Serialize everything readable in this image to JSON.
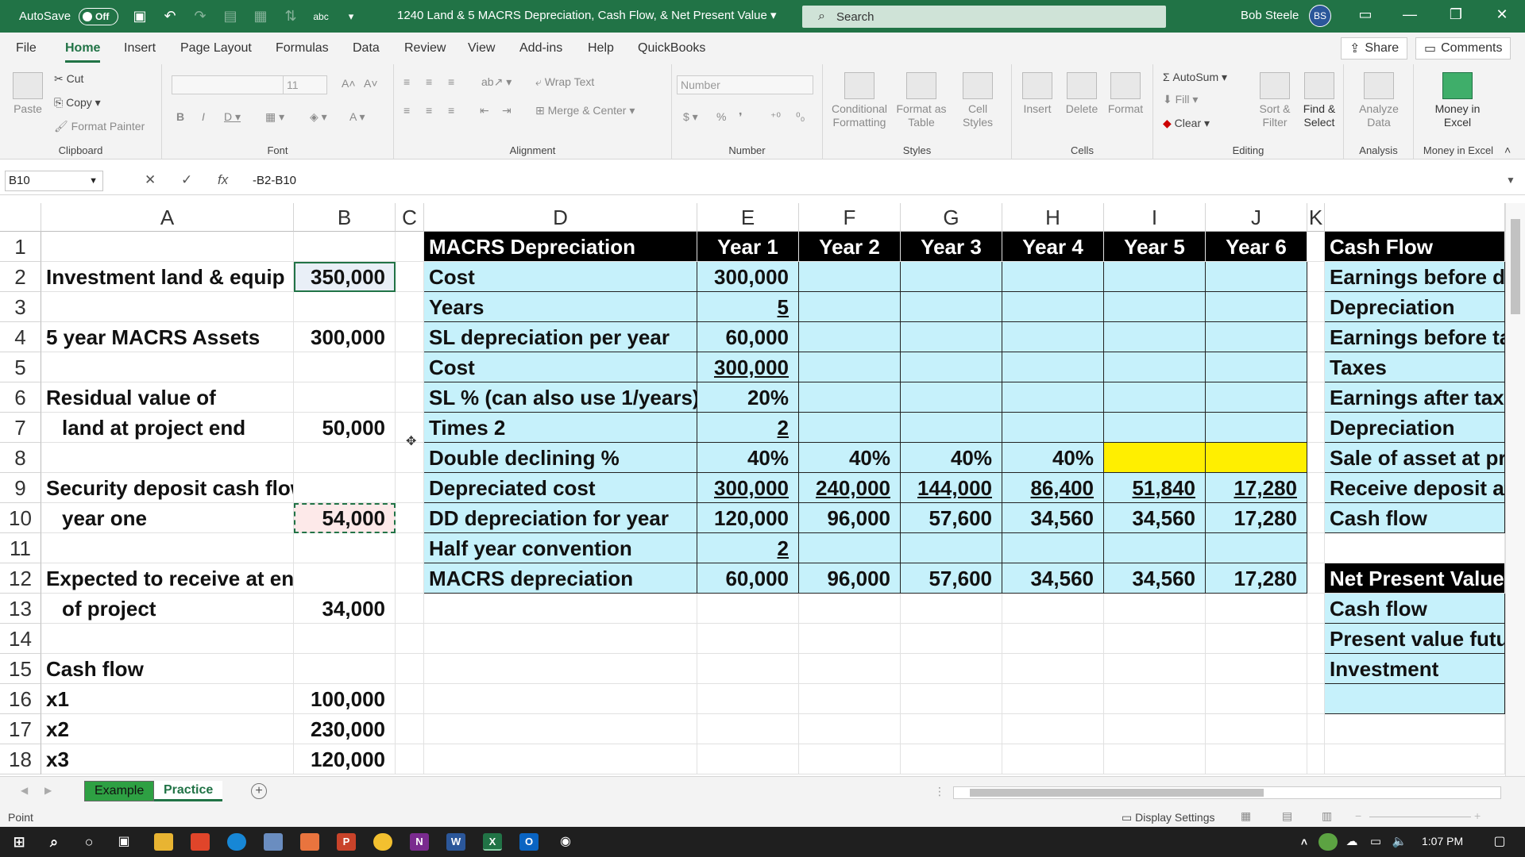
{
  "titlebar": {
    "autosave_label": "AutoSave",
    "autosave_state": "Off",
    "doc_title": "1240 Land & 5 MACRS Depreciation, Cash Flow, & Net Present Value",
    "search_placeholder": "Search",
    "user_name": "Bob Steele",
    "user_initials": "BS"
  },
  "menu": {
    "tabs": [
      "File",
      "Home",
      "Insert",
      "Page Layout",
      "Formulas",
      "Data",
      "Review",
      "View",
      "Add-ins",
      "Help",
      "QuickBooks"
    ],
    "active": "Home",
    "share": "Share",
    "comments": "Comments"
  },
  "ribbon": {
    "clipboard": {
      "label": "Clipboard",
      "paste": "Paste",
      "cut": "Cut",
      "copy": "Copy",
      "format_painter": "Format Painter"
    },
    "font": {
      "label": "Font",
      "size": "11"
    },
    "alignment": {
      "label": "Alignment",
      "wrap_text": "Wrap Text",
      "merge_center": "Merge & Center"
    },
    "number": {
      "label": "Number",
      "format": "Number"
    },
    "styles": {
      "label": "Styles",
      "conditional": "Conditional Formatting",
      "format_table": "Format as Table",
      "cell_styles": "Cell Styles"
    },
    "cells": {
      "label": "Cells",
      "insert": "Insert",
      "delete": "Delete",
      "format": "Format"
    },
    "editing": {
      "label": "Editing",
      "autosum": "AutoSum",
      "fill": "Fill",
      "clear": "Clear",
      "sort_filter": "Sort & Filter",
      "find_select": "Find & Select"
    },
    "analysis": {
      "label": "Analysis",
      "analyze_data": "Analyze Data"
    },
    "money": {
      "label": "Money in Excel",
      "money_in_excel": "Money in Excel"
    }
  },
  "formula_bar": {
    "name_box": "B10",
    "formula": "-B2-B10"
  },
  "columns": [
    "A",
    "B",
    "C",
    "D",
    "E",
    "F",
    "G",
    "H",
    "I",
    "J",
    "K"
  ],
  "rows": [
    "1",
    "2",
    "3",
    "4",
    "5",
    "6",
    "7",
    "8",
    "9",
    "10",
    "11",
    "12",
    "13",
    "14",
    "15",
    "16",
    "17",
    "18"
  ],
  "colA": {
    "r2": "Investment land & equip",
    "r4": "5 year MACRS Assets",
    "r6": "Residual value of",
    "r7": "land at project end",
    "r9": "Security deposit cash flow",
    "r10": "year one",
    "r12": "Expected to receive at end",
    "r13": "of project",
    "r15": "Cash flow",
    "r16": "x1",
    "r17": "x2",
    "r18": "x3"
  },
  "colB": {
    "r2": "350,000",
    "r4": "300,000",
    "r7": "50,000",
    "r10": "54,000",
    "r13": "34,000",
    "r16": "100,000",
    "r17": "230,000",
    "r18": "120,000"
  },
  "macrs": {
    "header": [
      "MACRS Depreciation",
      "Year 1",
      "Year 2",
      "Year 3",
      "Year 4",
      "Year 5",
      "Year 6"
    ],
    "rows": [
      {
        "label": "Cost",
        "values": [
          "300,000",
          "",
          "",
          "",
          "",
          ""
        ]
      },
      {
        "label": "Years",
        "values": [
          "5",
          "",
          "",
          "",
          "",
          ""
        ]
      },
      {
        "label": "SL depreciation per year",
        "values": [
          "60,000",
          "",
          "",
          "",
          "",
          ""
        ]
      },
      {
        "label": "Cost",
        "values": [
          "300,000",
          "",
          "",
          "",
          "",
          ""
        ]
      },
      {
        "label": "SL % (can also use 1/years)",
        "values": [
          "20%",
          "",
          "",
          "",
          "",
          ""
        ]
      },
      {
        "label": "Times 2",
        "values": [
          "2",
          "",
          "",
          "",
          "",
          ""
        ]
      },
      {
        "label": "Double declining %",
        "values": [
          "40%",
          "40%",
          "40%",
          "40%",
          "",
          ""
        ]
      },
      {
        "label": "Depreciated cost",
        "values": [
          "300,000",
          "240,000",
          "144,000",
          "86,400",
          "51,840",
          "17,280"
        ]
      },
      {
        "label": "DD depreciation for year",
        "values": [
          "120,000",
          "96,000",
          "57,600",
          "34,560",
          "34,560",
          "17,280"
        ]
      },
      {
        "label": "Half year convention",
        "values": [
          "2",
          "",
          "",
          "",
          "",
          ""
        ]
      },
      {
        "label": "MACRS depreciation",
        "values": [
          "60,000",
          "96,000",
          "57,600",
          "34,560",
          "34,560",
          "17,280"
        ]
      }
    ]
  },
  "cashflow": {
    "header": "Cash Flow",
    "items": [
      "Earnings before de",
      "Depreciation",
      "Earnings before ta",
      "Taxes",
      "Earnings after taxe",
      "Depreciation",
      "Sale of asset at pro",
      "Receive deposit at",
      "Cash flow"
    ]
  },
  "npv": {
    "header": "Net Present Value",
    "items": [
      "Cash flow",
      "Present value futu",
      "Investment",
      ""
    ]
  },
  "sheets": {
    "example": "Example",
    "practice": "Practice"
  },
  "status": {
    "mode": "Point",
    "display_settings": "Display Settings"
  },
  "taskbar": {
    "time": "1:07 PM"
  },
  "colors": {
    "accent": "#217346",
    "cell_blue": "#c6f1fb",
    "highlight_yellow": "#ffef00",
    "header_black": "#000000"
  }
}
